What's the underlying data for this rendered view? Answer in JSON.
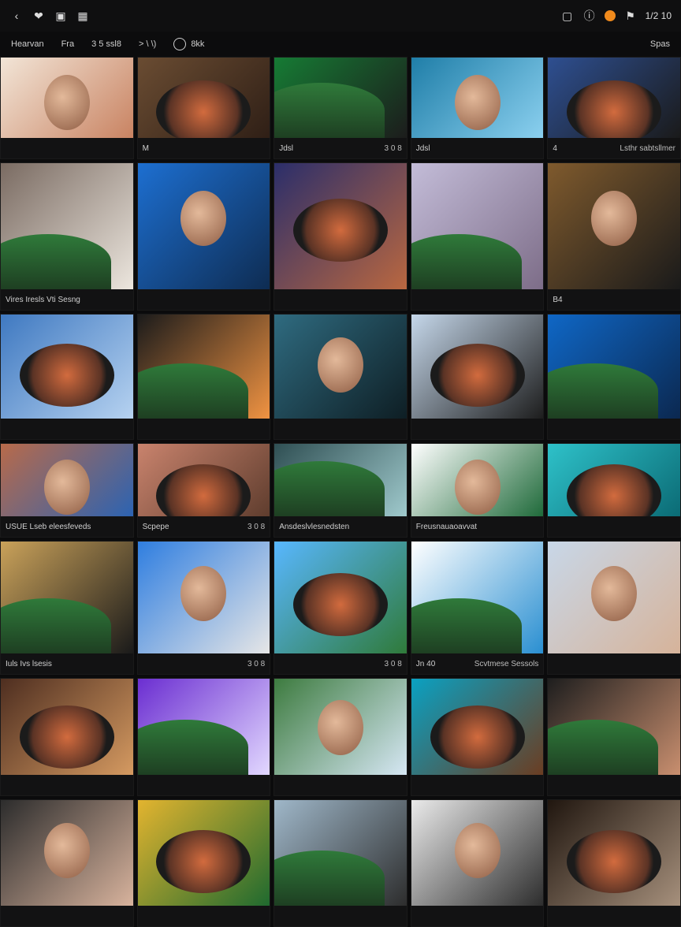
{
  "topbar": {
    "left_icons": [
      "back-icon",
      "heart-icon",
      "app-icon",
      "grid-icon"
    ],
    "right_icons": [
      "square-icon",
      "info-icon",
      "orange-dot-icon",
      "flag-icon"
    ],
    "status": "1/2  10"
  },
  "subbar": {
    "items": [
      "Hearvan",
      "Fra",
      "3 5 ssl8",
      "> \\ \\)",
      "8kk"
    ],
    "right_label": "Spas"
  },
  "tiles": [
    {
      "caption": "",
      "meta": "",
      "colors": [
        "#f2e5d7",
        "#c98362"
      ]
    },
    {
      "caption": "M",
      "meta": "",
      "colors": [
        "#6a4c32",
        "#2f1f16"
      ]
    },
    {
      "caption": "Jdsl",
      "meta": "3 0 8",
      "colors": [
        "#167b34",
        "#1c1c1c"
      ]
    },
    {
      "caption": "Jdsl",
      "meta": "",
      "colors": [
        "#1f7ea8",
        "#8bd0ef"
      ]
    },
    {
      "caption": "4",
      "meta": "Lsthr sabtsllmer",
      "colors": [
        "#2e4f91",
        "#1a1a1a"
      ]
    },
    {
      "caption": "Vires Iresls Vti Sesng",
      "meta": "",
      "colors": [
        "#7a6b62",
        "#ece6de"
      ]
    },
    {
      "caption": "",
      "meta": "",
      "colors": [
        "#1d6fd1",
        "#0e2c52"
      ]
    },
    {
      "caption": "",
      "meta": "",
      "colors": [
        "#2b2e6a",
        "#b96740"
      ]
    },
    {
      "caption": "",
      "meta": "",
      "colors": [
        "#c3bcd8",
        "#7d6d88"
      ]
    },
    {
      "caption": "B4",
      "meta": "",
      "colors": [
        "#7f5a2d",
        "#1a1a1a"
      ]
    },
    {
      "caption": "",
      "meta": "",
      "colors": [
        "#3f79c1",
        "#b6d2f0"
      ]
    },
    {
      "caption": "",
      "meta": "",
      "colors": [
        "#1b1b1b",
        "#f09342"
      ]
    },
    {
      "caption": "",
      "meta": "",
      "colors": [
        "#2f6b80",
        "#0e1e24"
      ]
    },
    {
      "caption": "",
      "meta": "",
      "colors": [
        "#c5d7ea",
        "#1d1d1d"
      ]
    },
    {
      "caption": "",
      "meta": "",
      "colors": [
        "#0f67c6",
        "#0b2850"
      ]
    },
    {
      "caption": "USUE Lseb eleesfeveds",
      "meta": "",
      "colors": [
        "#b86a4a",
        "#2c63b2"
      ]
    },
    {
      "caption": "Scpepe",
      "meta": "3 0 8",
      "colors": [
        "#c9836d",
        "#5f3d2e"
      ]
    },
    {
      "caption": "Ansdeslvlesnedsten",
      "meta": "",
      "colors": [
        "#2f4f53",
        "#9fc9cc"
      ]
    },
    {
      "caption": "Freusnauaoavvat",
      "meta": "",
      "colors": [
        "#ffffff",
        "#1f6a3a"
      ]
    },
    {
      "caption": "",
      "meta": "",
      "colors": [
        "#2ec1c9",
        "#0b6b75"
      ]
    },
    {
      "caption": "Iuls Ivs lsesis",
      "meta": "",
      "colors": [
        "#caa25a",
        "#1a1a1a"
      ]
    },
    {
      "caption": "",
      "meta": "3 0 8",
      "colors": [
        "#2f7ee0",
        "#e6e6e6"
      ]
    },
    {
      "caption": "",
      "meta": "3 0 8",
      "colors": [
        "#58b7ff",
        "#2f7a3a"
      ]
    },
    {
      "caption": "Jn 40",
      "meta": "Scvtmese Sessols",
      "colors": [
        "#ffffff",
        "#2a8fd1"
      ]
    },
    {
      "caption": "",
      "meta": "",
      "colors": [
        "#c8d7e8",
        "#d6b39a"
      ]
    },
    {
      "caption": "",
      "meta": "",
      "colors": [
        "#4e2e20",
        "#d59a61"
      ]
    },
    {
      "caption": "",
      "meta": "",
      "colors": [
        "#6b2ed1",
        "#e2d8ff"
      ]
    },
    {
      "caption": "",
      "meta": "",
      "colors": [
        "#3d7b3f",
        "#d6e7f4"
      ]
    },
    {
      "caption": "",
      "meta": "",
      "colors": [
        "#0aa1c2",
        "#6b3d22"
      ]
    },
    {
      "caption": "",
      "meta": "",
      "colors": [
        "#1e1e1e",
        "#c98f6f"
      ]
    },
    {
      "caption": "",
      "meta": "",
      "colors": [
        "#2c2c2c",
        "#d8b39d"
      ]
    },
    {
      "caption": "",
      "meta": "",
      "colors": [
        "#e3b42f",
        "#1f6a2f"
      ]
    },
    {
      "caption": "",
      "meta": "",
      "colors": [
        "#9fb7c9",
        "#2d2d2d"
      ]
    },
    {
      "caption": "",
      "meta": "",
      "colors": [
        "#eaeaea",
        "#2d2d2d"
      ]
    },
    {
      "caption": "",
      "meta": "",
      "colors": [
        "#20160f",
        "#a6907c"
      ]
    }
  ]
}
